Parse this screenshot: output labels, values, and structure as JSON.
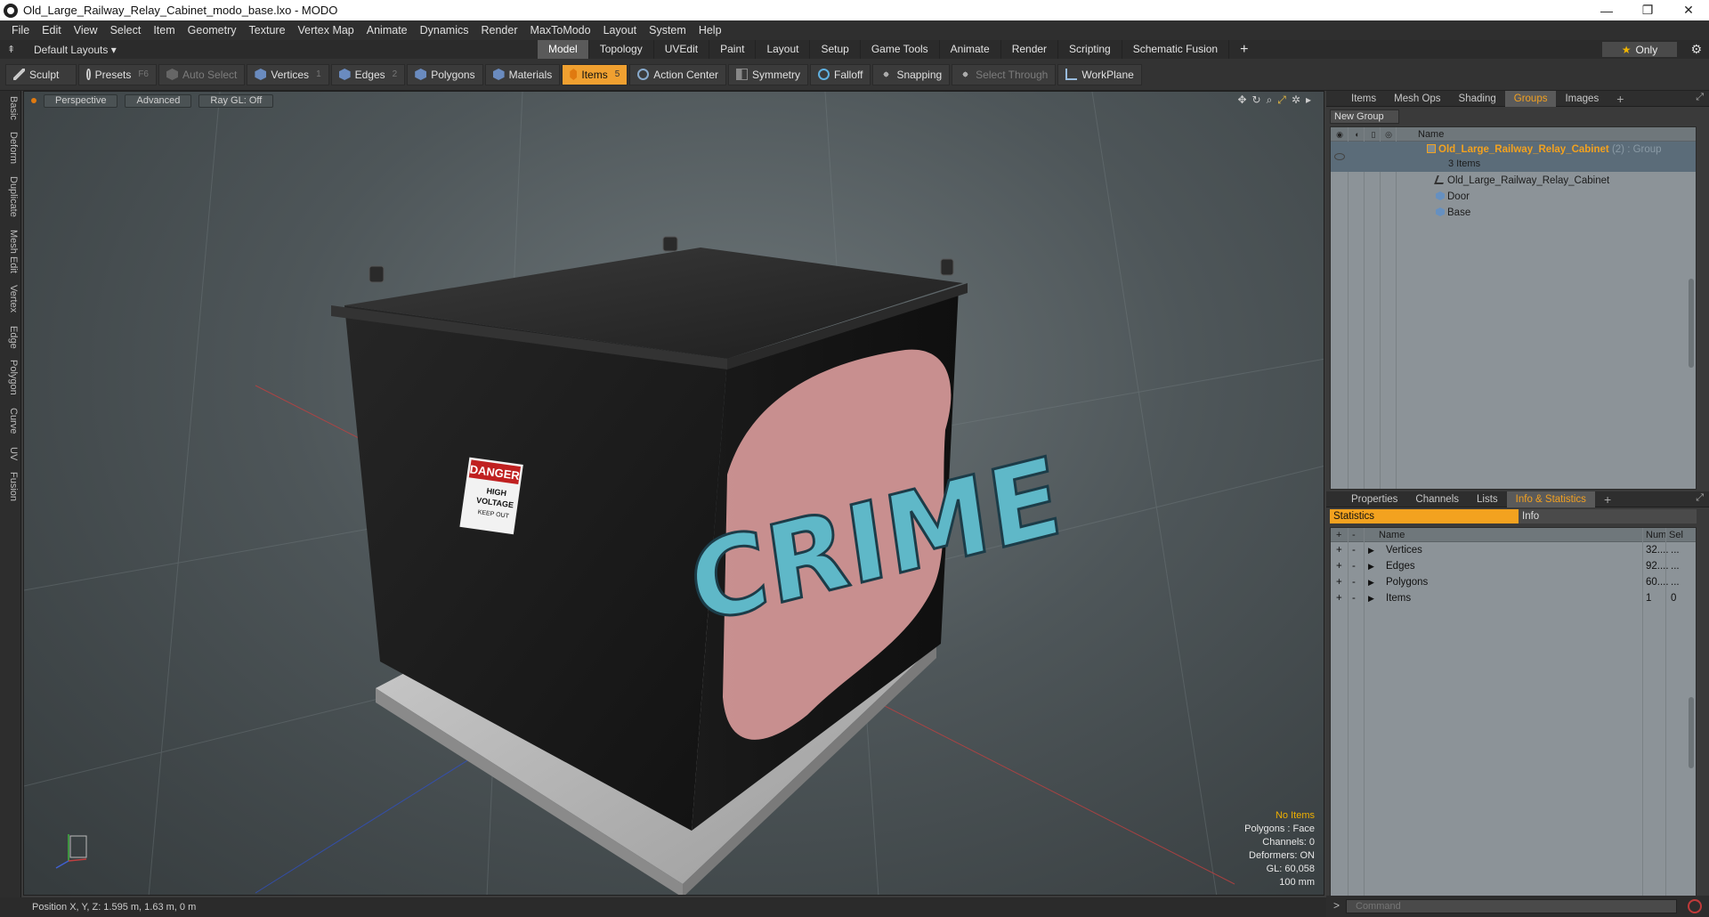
{
  "window": {
    "title": "Old_Large_Railway_Relay_Cabinet_modo_base.lxo - MODO",
    "controls": [
      "—",
      "❐",
      "✕"
    ]
  },
  "menu": [
    "File",
    "Edit",
    "View",
    "Select",
    "Item",
    "Geometry",
    "Texture",
    "Vertex Map",
    "Animate",
    "Dynamics",
    "Render",
    "MaxToModo",
    "Layout",
    "System",
    "Help"
  ],
  "layout_bar": {
    "layout_select": "Default Layouts ▾",
    "tabs": [
      "Model",
      "Topology",
      "UVEdit",
      "Paint",
      "Layout",
      "Setup",
      "Game Tools",
      "Animate",
      "Render",
      "Scripting",
      "Schematic Fusion"
    ],
    "active_tab": "Model",
    "add_tab": "+",
    "only_label": "Only"
  },
  "toolbar": {
    "sculpt": "Sculpt",
    "presets": "Presets",
    "presets_key": "F6",
    "auto_select": "Auto Select",
    "vertices": "Vertices",
    "vertices_key": "1",
    "edges": "Edges",
    "edges_key": "2",
    "polygons": "Polygons",
    "materials": "Materials",
    "items": "Items",
    "items_key": "5",
    "action_center": "Action Center",
    "symmetry": "Symmetry",
    "falloff": "Falloff",
    "snapping": "Snapping",
    "select_through": "Select Through",
    "workplane": "WorkPlane"
  },
  "left_tabs": [
    "Basic",
    "Deform",
    "Duplicate",
    "Mesh Edit",
    "Vertex",
    "Edge",
    "Polygon",
    "Curve",
    "UV",
    "Fusion"
  ],
  "viewport": {
    "view": "Perspective",
    "shading": "Advanced",
    "raygl": "Ray GL: Off",
    "stats": {
      "no_items": "No Items",
      "polygons": "Polygons : Face",
      "channels": "Channels: 0",
      "deformers": "Deformers: ON",
      "gl": "GL: 60,058",
      "scale": "100 mm"
    },
    "sign_text": "DANGER",
    "sign_sub1": "HIGH",
    "sign_sub2": "VOLTAGE",
    "sign_sub3": "KEEP OUT",
    "graffiti": "CRIME"
  },
  "status_bar": {
    "position": "Position X, Y, Z:  1.595 m, 1.63 m, 0 m"
  },
  "groups_panel": {
    "tabs": [
      "Items",
      "Mesh Ops",
      "Shading",
      "Groups",
      "Images"
    ],
    "active_tab": "Groups",
    "add_tab": "+",
    "new_group": "New Group",
    "column_name": "Name",
    "group": {
      "name": "Old_Large_Railway_Relay_Cabinet",
      "type": "(2) : Group",
      "count": "3 Items"
    },
    "children": [
      {
        "name": "Old_Large_Railway_Relay_Cabinet",
        "icon": "locator-icon"
      },
      {
        "name": "Door",
        "icon": "mesh-icon"
      },
      {
        "name": "Base",
        "icon": "mesh-icon"
      }
    ]
  },
  "props_panel": {
    "tabs": [
      "Properties",
      "Channels",
      "Lists",
      "Info & Statistics"
    ],
    "active_tab": "Info & Statistics",
    "add_tab": "+",
    "sub_tabs": [
      "Statistics",
      "Info"
    ],
    "columns": {
      "name": "Name",
      "num": "Num",
      "sel": "Sel"
    },
    "rows": [
      {
        "name": "Vertices",
        "num": "32....",
        "sel": "..."
      },
      {
        "name": "Edges",
        "num": "92....",
        "sel": "..."
      },
      {
        "name": "Polygons",
        "num": "60....",
        "sel": "..."
      },
      {
        "name": "Items",
        "num": "1",
        "sel": "0"
      }
    ]
  },
  "command": {
    "prompt": ">",
    "placeholder": "Command"
  },
  "colors": {
    "accent": "#f3a21f",
    "active_tool": "#f0a030"
  }
}
